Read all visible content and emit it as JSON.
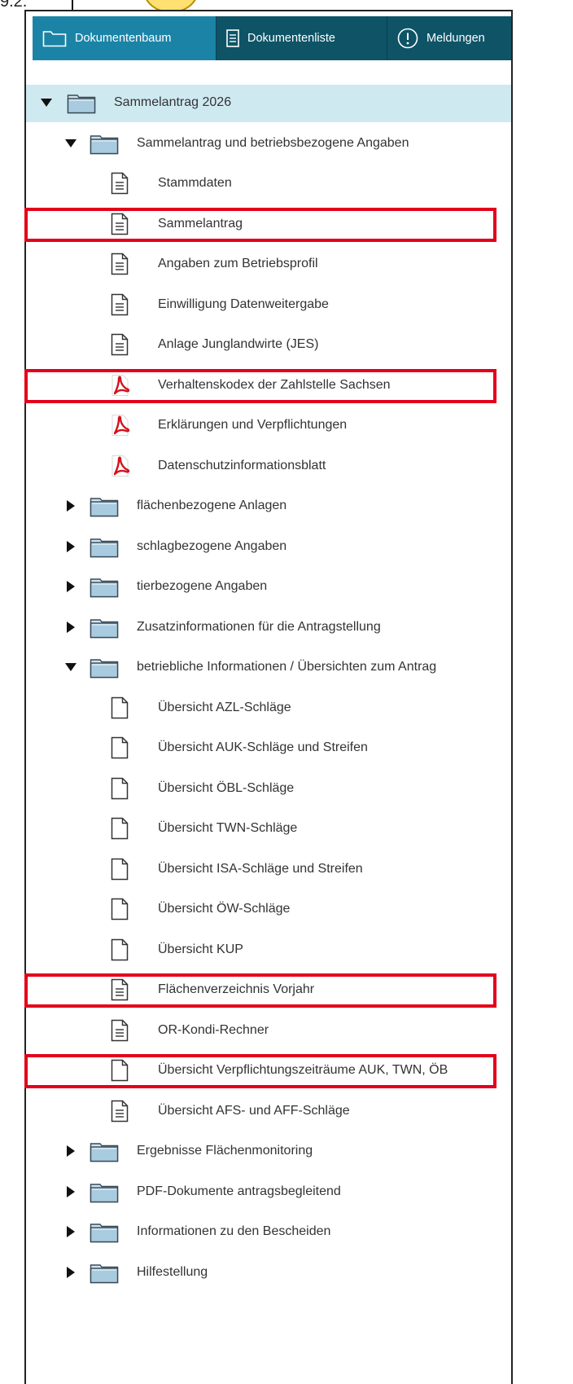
{
  "tabs": [
    {
      "label": "Dokumentenbaum",
      "icon": "folder-outline-icon",
      "active": true
    },
    {
      "label": "Dokumentenliste",
      "icon": "list-document-icon",
      "active": false
    },
    {
      "label": "Meldungen",
      "icon": "alert-circle-icon",
      "active": false
    }
  ],
  "tree": [
    {
      "label": "Sammelantrag 2026",
      "level": 0,
      "type": "folder",
      "expander": "expanded",
      "selected": true
    },
    {
      "label": "Sammelantrag und betriebsbezogene Angaben",
      "level": 1,
      "type": "folder",
      "expander": "expanded"
    },
    {
      "label": "Stammdaten",
      "level": 2,
      "type": "form"
    },
    {
      "label": "Sammelantrag",
      "level": 2,
      "type": "form"
    },
    {
      "label": "Angaben zum Betriebsprofil",
      "level": 2,
      "type": "form"
    },
    {
      "label": "Einwilligung Datenweitergabe",
      "level": 2,
      "type": "form"
    },
    {
      "label": "Anlage Junglandwirte (JES)",
      "level": 2,
      "type": "form"
    },
    {
      "label": "Verhaltenskodex der Zahlstelle Sachsen",
      "level": 2,
      "type": "pdf"
    },
    {
      "label": "Erklärungen und Verpflichtungen",
      "level": 2,
      "type": "pdf"
    },
    {
      "label": "Datenschutzinformationsblatt",
      "level": 2,
      "type": "pdf"
    },
    {
      "label": "flächenbezogene Anlagen",
      "level": 1,
      "type": "folder",
      "expander": "collapsed"
    },
    {
      "label": "schlagbezogene Angaben",
      "level": 1,
      "type": "folder",
      "expander": "collapsed"
    },
    {
      "label": "tierbezogene Angaben",
      "level": 1,
      "type": "folder",
      "expander": "collapsed"
    },
    {
      "label": "Zusatzinformationen für die Antragstellung",
      "level": 1,
      "type": "folder",
      "expander": "collapsed"
    },
    {
      "label": "betriebliche Informationen / Übersichten zum Antrag",
      "level": 1,
      "type": "folder",
      "expander": "expanded"
    },
    {
      "label": "Übersicht AZL-Schläge",
      "level": 2,
      "type": "blank"
    },
    {
      "label": "Übersicht AUK-Schläge und Streifen",
      "level": 2,
      "type": "blank"
    },
    {
      "label": "Übersicht ÖBL-Schläge",
      "level": 2,
      "type": "blank"
    },
    {
      "label": "Übersicht TWN-Schläge",
      "level": 2,
      "type": "blank"
    },
    {
      "label": "Übersicht ISA-Schläge und Streifen",
      "level": 2,
      "type": "blank"
    },
    {
      "label": "Übersicht ÖW-Schläge",
      "level": 2,
      "type": "blank"
    },
    {
      "label": "Übersicht KUP",
      "level": 2,
      "type": "blank"
    },
    {
      "label": "Flächenverzeichnis Vorjahr",
      "level": 2,
      "type": "form"
    },
    {
      "label": "OR-Kondi-Rechner",
      "level": 2,
      "type": "form"
    },
    {
      "label": "Übersicht Verpflichtungszeiträume AUK, TWN, ÖB",
      "level": 2,
      "type": "blank"
    },
    {
      "label": "Übersicht AFS- und AFF-Schläge",
      "level": 2,
      "type": "form"
    },
    {
      "label": "Ergebnisse Flächenmonitoring",
      "level": 1,
      "type": "folder",
      "expander": "collapsed"
    },
    {
      "label": "PDF-Dokumente antragsbegleitend",
      "level": 1,
      "type": "folder",
      "expander": "collapsed"
    },
    {
      "label": "Informationen zu den Bescheiden",
      "level": 1,
      "type": "folder",
      "expander": "collapsed"
    },
    {
      "label": "Hilfestellung",
      "level": 1,
      "type": "folder",
      "expander": "collapsed"
    }
  ],
  "highlighted_items": [
    "Sammelantrag",
    "Verhaltenskodex der Zahlstelle Sachsen",
    "Flächenverzeichnis Vorjahr",
    "Übersicht Verpflichtungszeiträume AUK, TWN, ÖB"
  ],
  "colors": {
    "tab_bar": "#0e5466",
    "tab_active": "#1b84a6",
    "selected_row": "#cfe9f1",
    "highlight_box": "#e3001b",
    "pdf_icon": "#d4111b"
  },
  "top_fragment": "9.2."
}
